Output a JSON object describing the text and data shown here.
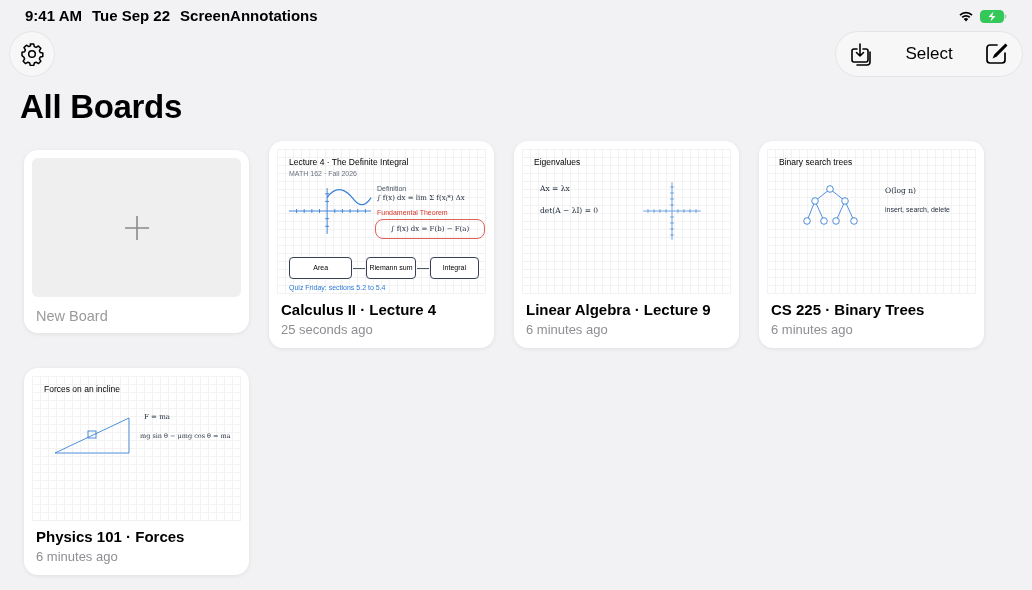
{
  "status_bar": {
    "time": "9:41 AM",
    "date": "Tue Sep 22",
    "app": "ScreenAnnotations",
    "charging": true
  },
  "toolbar": {
    "select_label": "Select"
  },
  "title": "All Boards",
  "boards": [
    {
      "kind": "new",
      "title": "New Board"
    },
    {
      "kind": "board",
      "title": "Calculus II · Lecture 4",
      "updated": "25 seconds ago",
      "thumbnail": {
        "kind": "calculus",
        "title": "Lecture 4 · The Definite Integral",
        "subtitle": "MATH 162 · Fall 2026",
        "definition_label": "Definition",
        "definition": "∫ f(x) dx = lim Σ f(x$_{i}$*) Δx",
        "theorem_label": "Fundamental Theorem",
        "theorem": "∫ f(x) dx = F(b) − F(a)",
        "flow": [
          "Area",
          "Riemann sum",
          "Integral"
        ],
        "note": "Quiz Friday: sections 5.2 to 5.4"
      }
    },
    {
      "kind": "board",
      "title": "Linear Algebra · Lecture 9",
      "updated": "6 minutes ago",
      "thumbnail": {
        "kind": "eigen",
        "title": "Eigenvalues",
        "formulas": [
          "Ax = λx",
          "det(A − λI) = 0"
        ]
      }
    },
    {
      "kind": "board",
      "title": "CS 225 · Binary Trees",
      "updated": "6 minutes ago",
      "thumbnail": {
        "kind": "tree",
        "title": "Binary search trees",
        "formulas": [
          "O(log n)",
          "insert, search, delete"
        ]
      }
    },
    {
      "kind": "board",
      "title": "Physics 101 · Forces",
      "updated": "6 minutes ago",
      "thumbnail": {
        "kind": "incline",
        "title": "Forces on an incline",
        "formulas": [
          "F = ma",
          "mg sin θ − μmg cos θ = ma"
        ]
      }
    }
  ]
}
